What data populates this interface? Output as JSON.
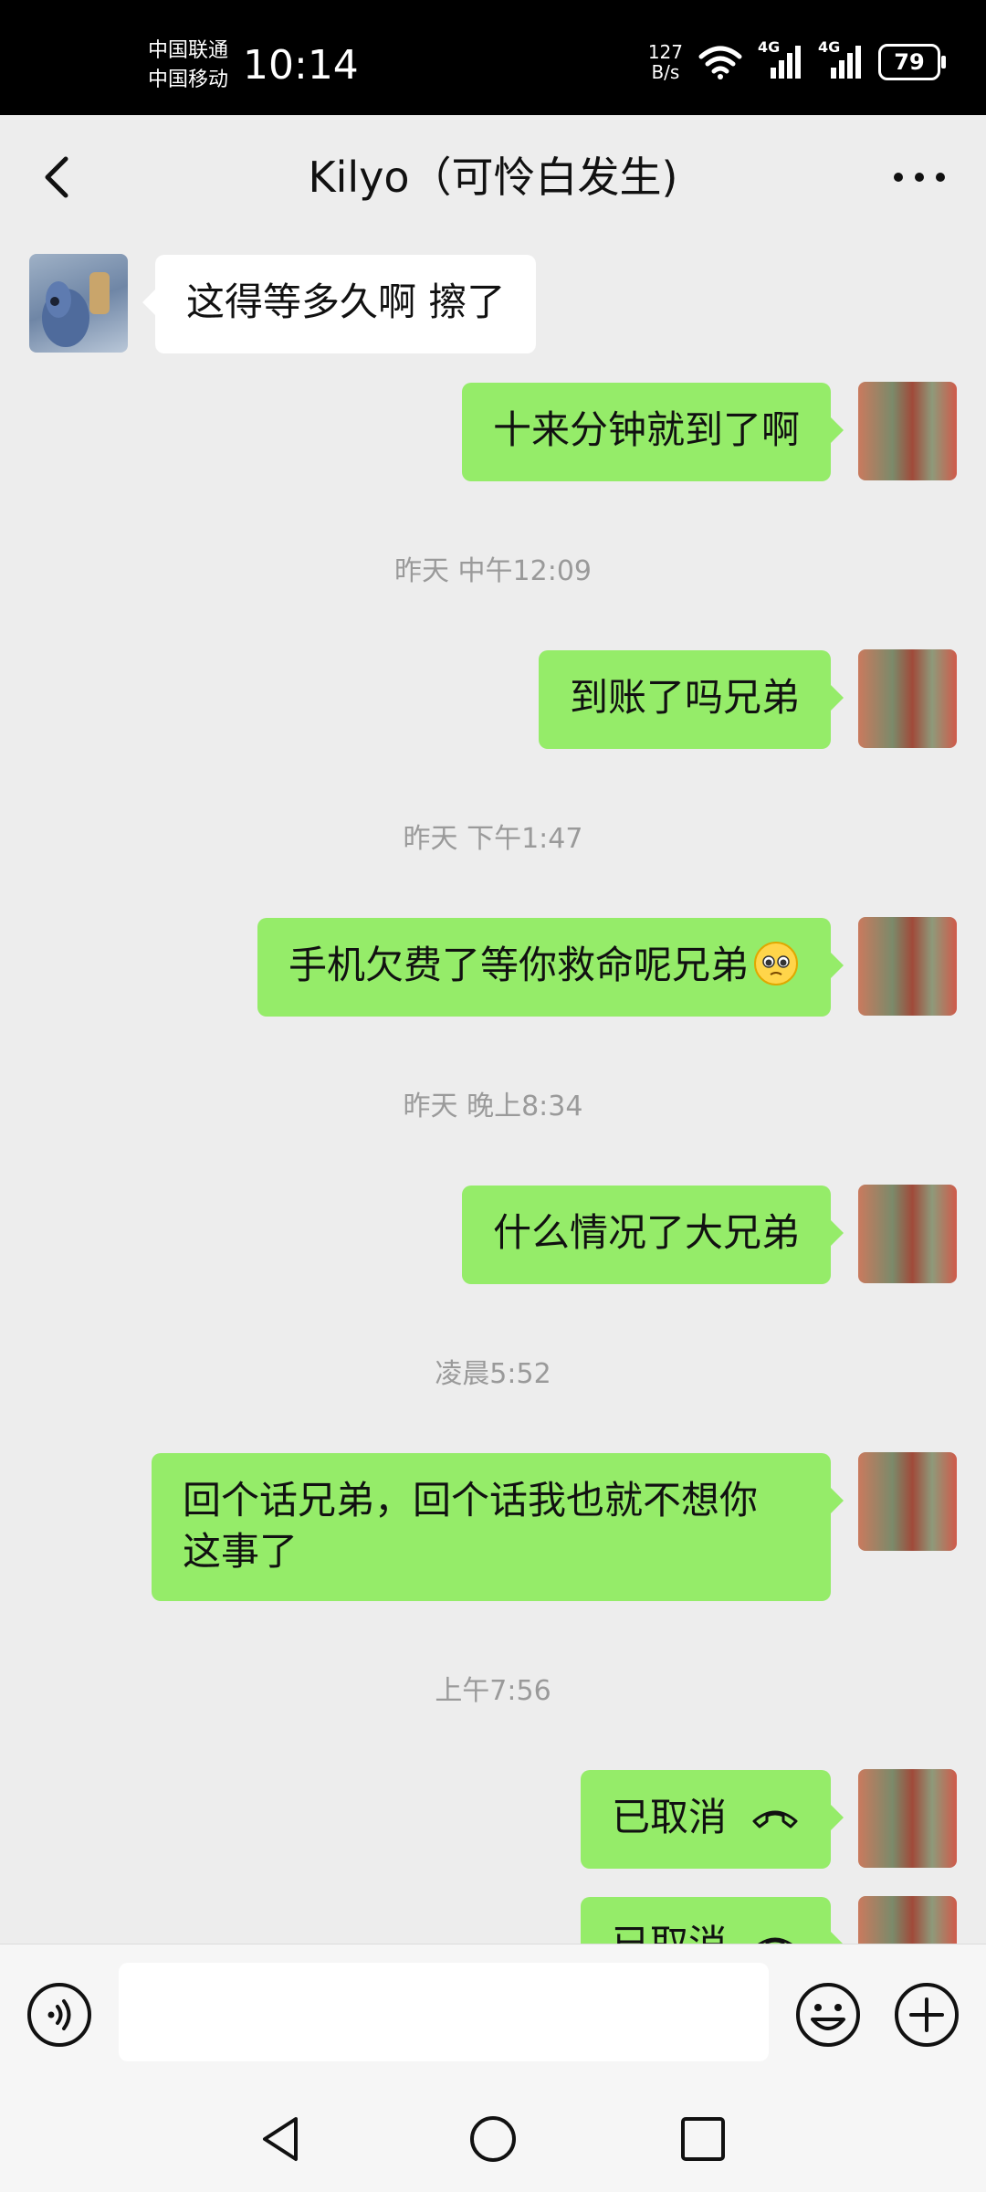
{
  "status_bar": {
    "carrier1": "中国联通",
    "carrier2": "中国移动",
    "time": "10:14",
    "speed_value": "127",
    "speed_unit": "B/s",
    "net1": "4G",
    "net2": "4G",
    "battery": "79"
  },
  "header": {
    "title": "Kilyo（可怜白发生)",
    "back_icon": "chevron-left-icon",
    "more_icon": "more-dots-icon"
  },
  "messages": {
    "m1": "这得等多久啊  擦了",
    "m2": "十来分钟就到了啊",
    "t1": "昨天 中午12:09",
    "m3": "到账了吗兄弟",
    "t2": "昨天 下午1:47",
    "m4": "手机欠费了等你救命呢兄弟",
    "t3": "昨天 晚上8:34",
    "m5": "什么情况了大兄弟",
    "t4": "凌晨5:52",
    "m6_line1": "回个话兄弟，回个话我也就不想你",
    "m6_line2": "这事了",
    "t5": "上午7:56",
    "m7": "已取消",
    "m8": "已取消"
  },
  "input_bar": {
    "voice_icon": "voice-icon",
    "emoji_icon": "emoji-icon",
    "plus_icon": "plus-icon",
    "input_value": ""
  },
  "nav_bar": {
    "back_icon": "nav-back-icon",
    "home_icon": "nav-home-icon",
    "recent_icon": "nav-recent-icon"
  },
  "colors": {
    "outgoing_bubble": "#95ec69",
    "incoming_bubble": "#ffffff",
    "background": "#ededed"
  }
}
